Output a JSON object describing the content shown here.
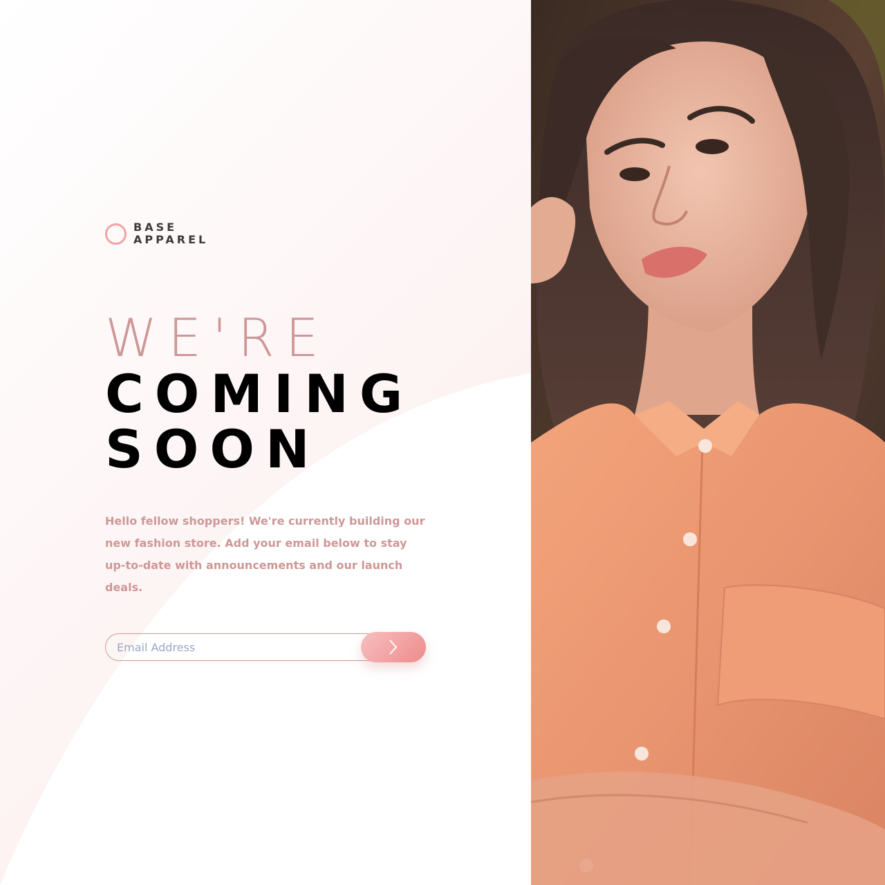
{
  "brand": {
    "line1": "BASE",
    "line2": "APPAREL",
    "logo_icon": "ring-icon",
    "accent_color": "#f0a4a4"
  },
  "hero": {
    "line1": "WE'RE",
    "line2": "COMING",
    "line3": "SOON"
  },
  "description": "Hello fellow shoppers! We're currently building our new fashion store. Add your email below to stay up-to-date with announcements and our launch deals.",
  "form": {
    "email_placeholder": "Email Address",
    "submit_icon": "chevron-right-icon"
  },
  "colors": {
    "desaturated_red": "#ce9797",
    "dark_grayish_red": "#423a3a",
    "button_gradient_start": "#f8bfbf",
    "button_gradient_end": "#ee8b8b"
  },
  "photo": {
    "subject": "woman-in-orange-shirt-photo"
  }
}
